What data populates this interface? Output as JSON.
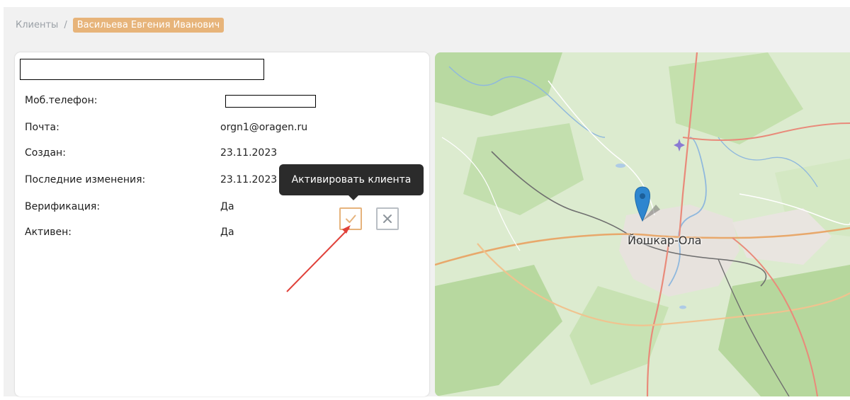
{
  "breadcrumb": {
    "root": "Клиенты",
    "separator": "/",
    "current": "Васильева Евгения Иванович"
  },
  "client": {
    "fields": [
      {
        "label": "Моб.телефон:",
        "value": ""
      },
      {
        "label": "Почта:",
        "value": "orgn1@oragen.ru"
      },
      {
        "label": "Создан:",
        "value": "23.11.2023"
      },
      {
        "label": "Последние изменения:",
        "value": "23.11.2023"
      },
      {
        "label": "Верификация:",
        "value": "Да"
      },
      {
        "label": "Активен:",
        "value": "Да"
      }
    ]
  },
  "actions": {
    "activate_icon": "check-icon",
    "deactivate_icon": "close-icon"
  },
  "tooltip": {
    "text": "Активировать клиента"
  },
  "map": {
    "city": "Йошкар-Ола"
  },
  "colors": {
    "accent": "#e6b37c",
    "tooltip_bg": "#2b2b2b",
    "marker": "#2e86cf",
    "annotation_arrow": "#e0413a"
  }
}
